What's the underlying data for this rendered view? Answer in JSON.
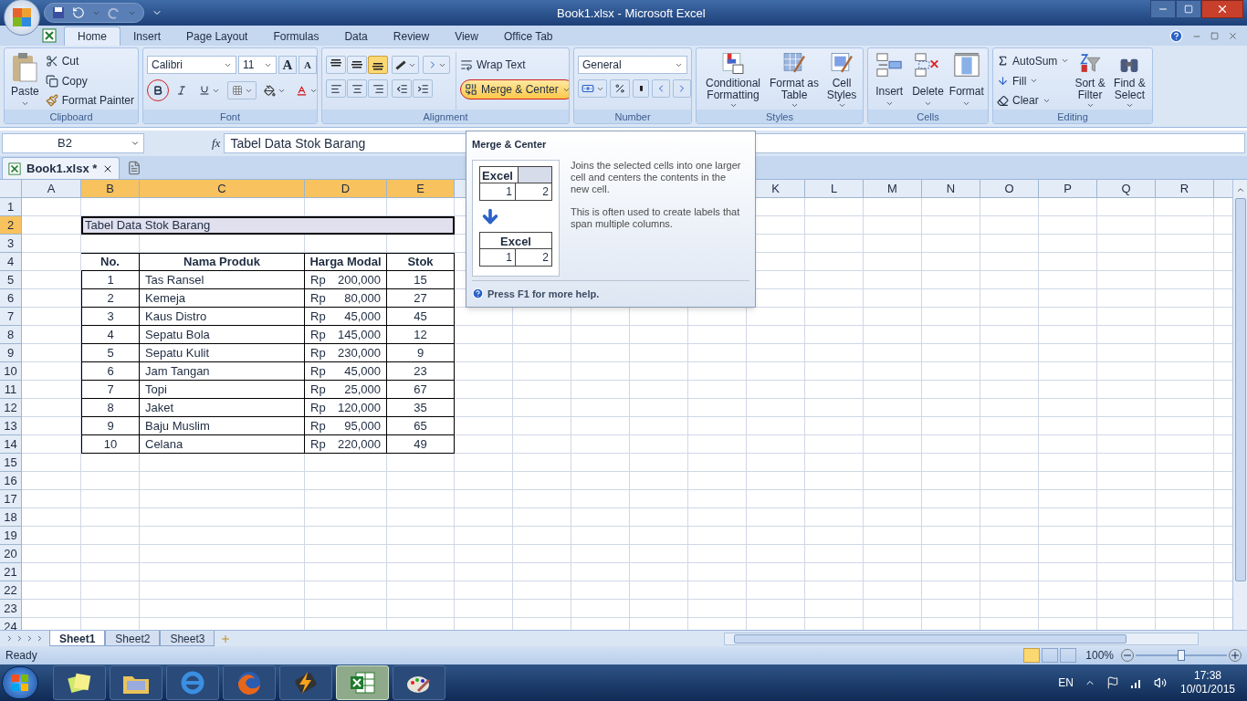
{
  "window": {
    "title": "Book1.xlsx - Microsoft Excel"
  },
  "ribbon_tabs": [
    {
      "label": "Home",
      "selected": true
    },
    {
      "label": "Insert",
      "selected": false
    },
    {
      "label": "Page Layout",
      "selected": false
    },
    {
      "label": "Formulas",
      "selected": false
    },
    {
      "label": "Data",
      "selected": false
    },
    {
      "label": "Review",
      "selected": false
    },
    {
      "label": "View",
      "selected": false
    },
    {
      "label": "Office Tab",
      "selected": false
    }
  ],
  "clipboard": {
    "label": "Clipboard",
    "paste": "Paste",
    "cut": "Cut",
    "copy": "Copy",
    "format_painter": "Format Painter"
  },
  "font": {
    "label": "Font",
    "font_name": "Calibri",
    "font_size": "11",
    "grow_font": "A",
    "shrink_font": "A",
    "bold_annotated": true
  },
  "alignment": {
    "label": "Alignment",
    "wrap_text": "Wrap Text",
    "merge_center": {
      "label": "Merge & Center",
      "highlighted": true,
      "annotated": true
    },
    "vertical_align": [
      {
        "kind": "top",
        "selected": false
      },
      {
        "kind": "middle",
        "selected": false
      },
      {
        "kind": "bottom",
        "selected": true
      }
    ]
  },
  "number": {
    "label": "Number",
    "format": "General"
  },
  "styles": {
    "label": "Styles",
    "buttons": [
      {
        "kind": "conditional",
        "label": "Conditional Formatting"
      },
      {
        "kind": "table",
        "label": "Format as Table"
      },
      {
        "kind": "cell",
        "label": "Cell Styles"
      }
    ]
  },
  "cells": {
    "label": "Cells",
    "buttons": [
      {
        "kind": "insert",
        "label": "Insert"
      },
      {
        "kind": "delete",
        "label": "Delete"
      },
      {
        "kind": "format",
        "label": "Format"
      }
    ]
  },
  "editing": {
    "label": "Editing",
    "autosum": "AutoSum",
    "fill": "Fill",
    "clear": "Clear",
    "sort_filter": "Sort & Filter",
    "find_select": "Find & Select"
  },
  "formula_bar": {
    "name_box": "B2",
    "fx": "fx",
    "value": "Tabel Data Stok Barang"
  },
  "workbook_tab": {
    "label": "Book1.xlsx *"
  },
  "columns": [
    {
      "label": "A",
      "selected": false
    },
    {
      "label": "B",
      "selected": true
    },
    {
      "label": "C",
      "selected": true
    },
    {
      "label": "D",
      "selected": true
    },
    {
      "label": "E",
      "selected": true
    },
    {
      "label": "K",
      "selected": false
    },
    {
      "label": "L",
      "selected": false
    },
    {
      "label": "M",
      "selected": false
    },
    {
      "label": "N",
      "selected": false
    },
    {
      "label": "O",
      "selected": false
    },
    {
      "label": "P",
      "selected": false
    },
    {
      "label": "Q",
      "selected": false
    },
    {
      "label": "R",
      "selected": false
    }
  ],
  "row_numbers": [
    {
      "label": "1",
      "selected": false
    },
    {
      "label": "2",
      "selected": true
    },
    {
      "label": "3",
      "selected": false
    },
    {
      "label": "4",
      "selected": false
    },
    {
      "label": "5",
      "selected": false
    },
    {
      "label": "6",
      "selected": false
    },
    {
      "label": "7",
      "selected": false
    },
    {
      "label": "8",
      "selected": false
    },
    {
      "label": "9",
      "selected": false
    },
    {
      "label": "10",
      "selected": false
    },
    {
      "label": "11",
      "selected": false
    },
    {
      "label": "12",
      "selected": false
    },
    {
      "label": "13",
      "selected": false
    },
    {
      "label": "14",
      "selected": false
    },
    {
      "label": "15",
      "selected": false
    },
    {
      "label": "16",
      "selected": false
    },
    {
      "label": "17",
      "selected": false
    },
    {
      "label": "18",
      "selected": false
    },
    {
      "label": "19",
      "selected": false
    },
    {
      "label": "20",
      "selected": false
    },
    {
      "label": "21",
      "selected": false
    },
    {
      "label": "22",
      "selected": false
    },
    {
      "label": "23",
      "selected": false
    },
    {
      "label": "24",
      "selected": false
    }
  ],
  "sheet": {
    "title": "Tabel Data Stok Barang",
    "headers": [
      "No.",
      "Nama Produk",
      "Harga Modal",
      "Stok"
    ],
    "rows": [
      {
        "no": "1",
        "name": "Tas Ransel",
        "currency": "Rp",
        "price": "200,000",
        "stock": "15"
      },
      {
        "no": "2",
        "name": "Kemeja",
        "currency": "Rp",
        "price": "80,000",
        "stock": "27"
      },
      {
        "no": "3",
        "name": "Kaus Distro",
        "currency": "Rp",
        "price": "45,000",
        "stock": "45"
      },
      {
        "no": "4",
        "name": "Sepatu Bola",
        "currency": "Rp",
        "price": "145,000",
        "stock": "12"
      },
      {
        "no": "5",
        "name": "Sepatu Kulit",
        "currency": "Rp",
        "price": "230,000",
        "stock": "9"
      },
      {
        "no": "6",
        "name": "Jam Tangan",
        "currency": "Rp",
        "price": "45,000",
        "stock": "23"
      },
      {
        "no": "7",
        "name": "Topi",
        "currency": "Rp",
        "price": "25,000",
        "stock": "67"
      },
      {
        "no": "8",
        "name": "Jaket",
        "currency": "Rp",
        "price": "120,000",
        "stock": "35"
      },
      {
        "no": "9",
        "name": "Baju Muslim",
        "currency": "Rp",
        "price": "95,000",
        "stock": "65"
      },
      {
        "no": "10",
        "name": "Celana",
        "currency": "Rp",
        "price": "220,000",
        "stock": "49"
      }
    ]
  },
  "tooltip": {
    "title": "Merge & Center",
    "description": "Joins the selected cells into one larger cell and centers the contents in the new cell.",
    "note": "This is often used to create labels that span multiple columns.",
    "example_before": {
      "header": "Excel",
      "values": [
        "1",
        "2"
      ]
    },
    "example_after": {
      "header": "Excel",
      "values": [
        "1",
        "2"
      ]
    },
    "help": "Press F1 for more help."
  },
  "sheet_tabs": [
    {
      "label": "Sheet1",
      "selected": true
    },
    {
      "label": "Sheet2",
      "selected": false
    },
    {
      "label": "Sheet3",
      "selected": false
    }
  ],
  "status_bar": {
    "status": "Ready",
    "zoom": "100%",
    "level": 0.5
  },
  "taskbar": {
    "apps": [
      {
        "kind": "notes",
        "selected": false
      },
      {
        "kind": "folder",
        "selected": false
      },
      {
        "kind": "browser",
        "selected": false
      },
      {
        "kind": "fox",
        "selected": false
      },
      {
        "kind": "bolt",
        "selected": false
      },
      {
        "kind": "excel",
        "selected": true
      },
      {
        "kind": "paint",
        "selected": false
      }
    ],
    "language": "EN",
    "time": "17:38",
    "date": "10/01/2015"
  }
}
